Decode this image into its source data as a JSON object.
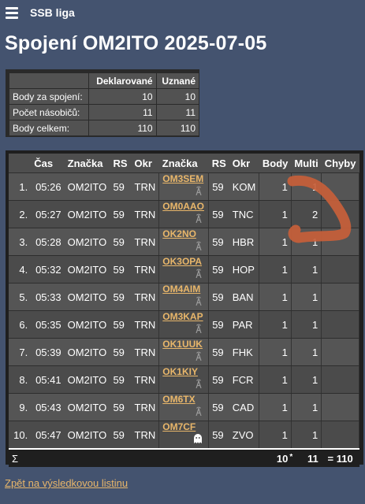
{
  "app": {
    "title": "SSB liga"
  },
  "page": {
    "title": "Spojení OM2ITO 2025-07-05"
  },
  "summary": {
    "headers": [
      "Deklarované",
      "Uznané"
    ],
    "rows": [
      {
        "label": "Body za spojení:",
        "declared": "10",
        "recognized": "10"
      },
      {
        "label": "Počet násobičů:",
        "declared": "11",
        "recognized": "11"
      },
      {
        "label": "Body celkem:",
        "declared": "110",
        "recognized": "110"
      }
    ]
  },
  "qso": {
    "headers": {
      "nr": "",
      "time": "Čas",
      "call": "Značka",
      "rs": "RS",
      "okr": "Okr",
      "call2": "Značka",
      "rs2": "RS",
      "okr2": "Okr",
      "points": "Body",
      "multi": "Multi",
      "errors": "Chyby"
    },
    "rows": [
      {
        "nr": "1.",
        "time": "05:26",
        "call": "OM2ITO",
        "rs": "59",
        "okr": "TRN",
        "call2": "OM3SEM",
        "icon": "tower-icon",
        "rs2": "59",
        "okr2": "KOM",
        "points": "1",
        "multi": "1",
        "errors": ""
      },
      {
        "nr": "2.",
        "time": "05:27",
        "call": "OM2ITO",
        "rs": "59",
        "okr": "TRN",
        "call2": "OM0AAO",
        "icon": "tower-icon",
        "rs2": "59",
        "okr2": "TNC",
        "points": "1",
        "multi": "2",
        "errors": ""
      },
      {
        "nr": "3.",
        "time": "05:28",
        "call": "OM2ITO",
        "rs": "59",
        "okr": "TRN",
        "call2": "OK2NO",
        "icon": "tower-icon",
        "rs2": "59",
        "okr2": "HBR",
        "points": "1",
        "multi": "1",
        "errors": ""
      },
      {
        "nr": "4.",
        "time": "05:32",
        "call": "OM2ITO",
        "rs": "59",
        "okr": "TRN",
        "call2": "OK3OPA",
        "icon": "tower-icon",
        "rs2": "59",
        "okr2": "HOP",
        "points": "1",
        "multi": "1",
        "errors": ""
      },
      {
        "nr": "5.",
        "time": "05:33",
        "call": "OM2ITO",
        "rs": "59",
        "okr": "TRN",
        "call2": "OM4AIM",
        "icon": "tower-icon",
        "rs2": "59",
        "okr2": "BAN",
        "points": "1",
        "multi": "1",
        "errors": ""
      },
      {
        "nr": "6.",
        "time": "05:35",
        "call": "OM2ITO",
        "rs": "59",
        "okr": "TRN",
        "call2": "OM3KAP",
        "icon": "tower-icon",
        "rs2": "59",
        "okr2": "PAR",
        "points": "1",
        "multi": "1",
        "errors": ""
      },
      {
        "nr": "7.",
        "time": "05:39",
        "call": "OM2ITO",
        "rs": "59",
        "okr": "TRN",
        "call2": "OK1UUK",
        "icon": "tower-icon",
        "rs2": "59",
        "okr2": "FHK",
        "points": "1",
        "multi": "1",
        "errors": ""
      },
      {
        "nr": "8.",
        "time": "05:41",
        "call": "OM2ITO",
        "rs": "59",
        "okr": "TRN",
        "call2": "OK1KIY",
        "icon": "tower-icon",
        "rs2": "59",
        "okr2": "FCR",
        "points": "1",
        "multi": "1",
        "errors": ""
      },
      {
        "nr": "9.",
        "time": "05:43",
        "call": "OM2ITO",
        "rs": "59",
        "okr": "TRN",
        "call2": "OM6TX",
        "icon": "tower-icon",
        "rs2": "59",
        "okr2": "CAD",
        "points": "1",
        "multi": "1",
        "errors": ""
      },
      {
        "nr": "10.",
        "time": "05:47",
        "call": "OM2ITO",
        "rs": "59",
        "okr": "TRN",
        "call2": "OM7CF",
        "icon": "ghost-icon",
        "rs2": "59",
        "okr2": "ZVO",
        "points": "1",
        "multi": "1",
        "errors": ""
      }
    ],
    "sum": {
      "symbol": "Σ",
      "points": "10",
      "times": "*",
      "multi": "11",
      "total": "= 110"
    }
  },
  "back_link": "Zpět na výsledkovou listinu",
  "colors": {
    "background": "#44536f",
    "link": "#e8b66a",
    "annotation": "#c8603a"
  }
}
